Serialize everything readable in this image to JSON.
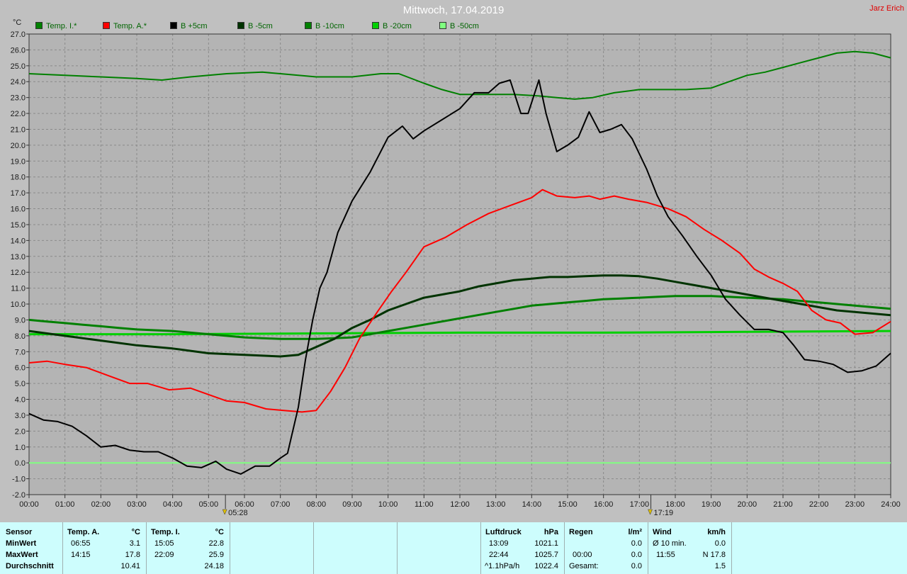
{
  "chart_data": {
    "type": "line",
    "title": "Mittwoch, 17.04.2019",
    "author": "Jarz Erich",
    "ylabel": "°C",
    "ylim": [
      -2.0,
      27.0
    ],
    "xlim": [
      0,
      24
    ],
    "yticks": [
      "27.0",
      "26.0",
      "25.0",
      "24.0",
      "23.0",
      "22.0",
      "21.0",
      "20.0",
      "19.0",
      "18.0",
      "17.0",
      "16.0",
      "15.0",
      "14.0",
      "13.0",
      "12.0",
      "11.0",
      "10.0",
      "9.0",
      "8.0",
      "7.0",
      "6.0",
      "5.0",
      "4.0",
      "3.0",
      "2.0",
      "1.0",
      "0.0",
      "-1.0",
      "-2.0"
    ],
    "xticks": [
      "00:00",
      "01:00",
      "02:00",
      "03:00",
      "04:00",
      "05:00",
      "06:00",
      "07:00",
      "08:00",
      "09:00",
      "10:00",
      "11:00",
      "12:00",
      "13:00",
      "14:00",
      "15:00",
      "16:00",
      "17:00",
      "18:00",
      "19:00",
      "20:00",
      "21:00",
      "22:00",
      "23:00",
      "24:00"
    ],
    "grid": true,
    "markers": [
      {
        "label": "05:28",
        "x": 5.47
      },
      {
        "label": "17:19",
        "x": 17.32
      }
    ],
    "series": [
      {
        "name": "Temp. I.*",
        "color": "#008000",
        "x": [
          0,
          1,
          2,
          3,
          3.7,
          4.5,
          5.5,
          6.5,
          7,
          8,
          9,
          9.8,
          10.3,
          11,
          11.5,
          12,
          12.7,
          13.5,
          14.2,
          14.7,
          15.2,
          15.7,
          16.3,
          17,
          17.7,
          18.3,
          19,
          19.5,
          20,
          20.5,
          21,
          21.5,
          22,
          22.5,
          23,
          23.5,
          24
        ],
        "y": [
          24.5,
          24.4,
          24.3,
          24.2,
          24.1,
          24.3,
          24.5,
          24.6,
          24.5,
          24.3,
          24.3,
          24.5,
          24.5,
          23.9,
          23.5,
          23.2,
          23.2,
          23.2,
          23.1,
          23.0,
          22.9,
          23.0,
          23.3,
          23.5,
          23.5,
          23.5,
          23.6,
          24.0,
          24.4,
          24.6,
          24.9,
          25.2,
          25.5,
          25.8,
          25.9,
          25.8,
          25.5
        ]
      },
      {
        "name": "Temp. A.*",
        "color": "#ff0000",
        "x": [
          0,
          0.5,
          1,
          1.6,
          2.2,
          2.8,
          3.3,
          3.9,
          4.5,
          5,
          5.5,
          6,
          6.6,
          7.1,
          7.6,
          8,
          8.4,
          8.8,
          9.2,
          9.7,
          10.1,
          10.5,
          11,
          11.6,
          12.2,
          12.8,
          13.4,
          14,
          14.3,
          14.7,
          15.2,
          15.6,
          15.9,
          16.3,
          16.7,
          17.2,
          17.8,
          18.3,
          18.8,
          19.3,
          19.8,
          20.2,
          20.6,
          21,
          21.4,
          21.8,
          22.2,
          22.6,
          23,
          23.5,
          24
        ],
        "y": [
          6.3,
          6.4,
          6.2,
          6.0,
          5.5,
          5.0,
          5.0,
          4.6,
          4.7,
          4.3,
          3.9,
          3.8,
          3.4,
          3.3,
          3.2,
          3.3,
          4.5,
          6.0,
          7.8,
          9.5,
          10.8,
          12.0,
          13.6,
          14.2,
          15.0,
          15.7,
          16.2,
          16.7,
          17.2,
          16.8,
          16.7,
          16.8,
          16.6,
          16.8,
          16.6,
          16.4,
          16.0,
          15.5,
          14.7,
          14.0,
          13.2,
          12.2,
          11.7,
          11.3,
          10.8,
          9.6,
          9.0,
          8.8,
          8.1,
          8.2,
          8.9
        ]
      },
      {
        "name": "B +5cm",
        "color": "#000000",
        "x": [
          0,
          0.4,
          0.8,
          1.2,
          1.6,
          2,
          2.4,
          2.8,
          3.2,
          3.6,
          4,
          4.4,
          4.8,
          5.2,
          5.5,
          5.9,
          6.3,
          6.7,
          7,
          7.2,
          7.5,
          7.7,
          7.9,
          8.1,
          8.3,
          8.6,
          9,
          9.5,
          10,
          10.4,
          10.7,
          11,
          11.5,
          12,
          12.4,
          12.8,
          13.1,
          13.4,
          13.7,
          13.9,
          14.2,
          14.4,
          14.7,
          15,
          15.3,
          15.6,
          15.9,
          16.2,
          16.5,
          16.8,
          17.2,
          17.5,
          17.8,
          18.2,
          18.6,
          19,
          19.4,
          19.8,
          20.2,
          20.6,
          21,
          21.3,
          21.6,
          22,
          22.4,
          22.8,
          23.2,
          23.6,
          24
        ],
        "y": [
          3.1,
          2.7,
          2.6,
          2.3,
          1.7,
          1.0,
          1.1,
          0.8,
          0.7,
          0.7,
          0.3,
          -0.2,
          -0.3,
          0.1,
          -0.4,
          -0.7,
          -0.2,
          -0.2,
          0.3,
          0.6,
          3.5,
          6.5,
          9.0,
          11.0,
          12.0,
          14.5,
          16.5,
          18.3,
          20.5,
          21.2,
          20.4,
          20.9,
          21.6,
          22.3,
          23.3,
          23.3,
          23.9,
          24.1,
          22.0,
          22.0,
          24.1,
          22.0,
          19.6,
          20.0,
          20.5,
          22.1,
          20.8,
          21.0,
          21.3,
          20.4,
          18.5,
          16.8,
          15.5,
          14.3,
          13.0,
          11.8,
          10.3,
          9.3,
          8.4,
          8.4,
          8.2,
          7.4,
          6.5,
          6.4,
          6.2,
          5.7,
          5.8,
          6.1,
          6.9
        ]
      },
      {
        "name": "B -5cm",
        "color": "#003300",
        "x": [
          0,
          1,
          2,
          3,
          4,
          5,
          6,
          7,
          7.5,
          8,
          8.5,
          9,
          9.5,
          10,
          10.5,
          11,
          11.5,
          12,
          12.5,
          13,
          13.5,
          14,
          14.5,
          15,
          15.5,
          16,
          16.5,
          17,
          17.5,
          18,
          18.5,
          19,
          19.5,
          20,
          20.5,
          21,
          21.5,
          22,
          22.5,
          23,
          23.5,
          24
        ],
        "y": [
          8.3,
          8.0,
          7.7,
          7.4,
          7.2,
          6.9,
          6.8,
          6.7,
          6.8,
          7.3,
          7.8,
          8.5,
          9.0,
          9.6,
          10.0,
          10.4,
          10.6,
          10.8,
          11.1,
          11.3,
          11.5,
          11.6,
          11.7,
          11.7,
          11.75,
          11.8,
          11.8,
          11.75,
          11.6,
          11.4,
          11.2,
          11.0,
          10.8,
          10.6,
          10.4,
          10.2,
          10.0,
          9.8,
          9.6,
          9.5,
          9.4,
          9.3
        ]
      },
      {
        "name": "B -10cm",
        "color": "#008000",
        "x": [
          0,
          0.5,
          1,
          1.5,
          2,
          2.5,
          3,
          3.5,
          4,
          4.5,
          5,
          5.5,
          6,
          6.5,
          7,
          7.5,
          8,
          8.5,
          9,
          9.5,
          10,
          10.5,
          11,
          11.5,
          12,
          12.5,
          13,
          13.5,
          14,
          14.5,
          15,
          15.5,
          16,
          16.5,
          17,
          17.5,
          18,
          18.5,
          19,
          19.5,
          20,
          20.5,
          21,
          21.5,
          22,
          22.5,
          23,
          23.5,
          24
        ],
        "y": [
          9.0,
          8.9,
          8.8,
          8.7,
          8.6,
          8.5,
          8.4,
          8.35,
          8.3,
          8.2,
          8.1,
          8.0,
          7.9,
          7.85,
          7.8,
          7.8,
          7.8,
          7.85,
          7.9,
          8.1,
          8.3,
          8.5,
          8.7,
          8.9,
          9.1,
          9.3,
          9.5,
          9.7,
          9.9,
          10.0,
          10.1,
          10.2,
          10.3,
          10.35,
          10.4,
          10.45,
          10.5,
          10.5,
          10.5,
          10.45,
          10.4,
          10.35,
          10.3,
          10.2,
          10.1,
          10.0,
          9.9,
          9.8,
          9.7
        ]
      },
      {
        "name": "B -20cm",
        "color": "#00d000",
        "x": [
          0,
          4,
          8,
          12,
          16,
          20,
          24
        ],
        "y": [
          8.1,
          8.1,
          8.15,
          8.2,
          8.2,
          8.25,
          8.3
        ]
      },
      {
        "name": "B -50cm",
        "color": "#80ff80",
        "x": [
          0,
          24
        ],
        "y": [
          0.0,
          0.0
        ]
      }
    ]
  },
  "table": {
    "sensor": {
      "header": "Sensor",
      "rows": [
        "MinWert",
        "MaxWert",
        "Durchschnitt"
      ]
    },
    "temp_a": {
      "header": "Temp. A.",
      "unit": "°C",
      "rows": [
        [
          "06:55",
          "3.1"
        ],
        [
          "14:15",
          "17.8"
        ],
        [
          "",
          "10.41"
        ]
      ]
    },
    "temp_i": {
      "header": "Temp. I.",
      "unit": "°C",
      "rows": [
        [
          "15:05",
          "22.8"
        ],
        [
          "22:09",
          "25.9"
        ],
        [
          "",
          "24.18"
        ]
      ]
    },
    "luftdruck": {
      "header": "Luftdruck",
      "unit": "hPa",
      "rows": [
        [
          "13:09",
          "1021.1"
        ],
        [
          "22:44",
          "1025.7"
        ],
        [
          "^1.1hPa/h",
          "1022.4"
        ]
      ]
    },
    "regen": {
      "header": "Regen",
      "unit": "l/m²",
      "rows": [
        [
          "",
          ""
        ],
        [
          "00:00",
          "0.0"
        ],
        [
          "Gesamt:",
          "0.0"
        ]
      ],
      "first_value": "0.0"
    },
    "wind": {
      "header": "Wind",
      "unit": "km/h",
      "rows": [
        [
          "Ø 10 min.",
          "0.0"
        ],
        [
          "11:55",
          "N 17.8"
        ],
        [
          "",
          "1.5"
        ]
      ]
    }
  }
}
